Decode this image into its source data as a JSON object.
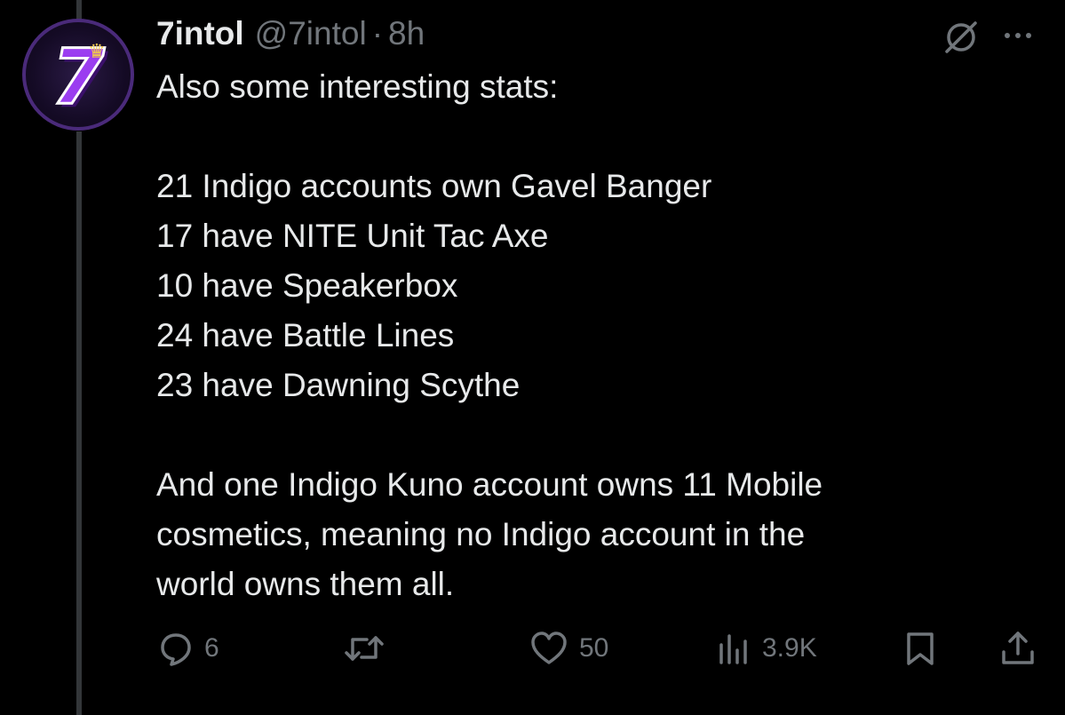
{
  "tweet": {
    "author": {
      "display_name": "7intol",
      "handle": "@7intol",
      "time": "8h"
    },
    "separator": "·",
    "text_lines": [
      "Also some interesting stats:",
      "",
      "21 Indigo accounts own Gavel Banger",
      "17 have NITE Unit Tac Axe",
      "10 have Speakerbox",
      "24 have Battle Lines",
      "23 have Dawning Scythe",
      "",
      "And one Indigo Kuno account owns 11 Mobile",
      "cosmetics, meaning no Indigo account in the",
      "world owns them all."
    ],
    "avatar_glyph": "7",
    "metrics": {
      "replies": "6",
      "likes": "50",
      "views": "3.9K"
    }
  },
  "icons": {
    "reply": "reply-icon",
    "retweet": "retweet-icon",
    "like": "heart-icon",
    "views": "views-icon",
    "bookmark": "bookmark-icon",
    "share": "share-icon",
    "grok": "grok-icon",
    "more": "more-icon"
  },
  "colors": {
    "background": "#000000",
    "text": "#e7e9ea",
    "secondary": "#71767b",
    "thread_line": "#333639",
    "avatar_accent": "#9b3df0"
  }
}
